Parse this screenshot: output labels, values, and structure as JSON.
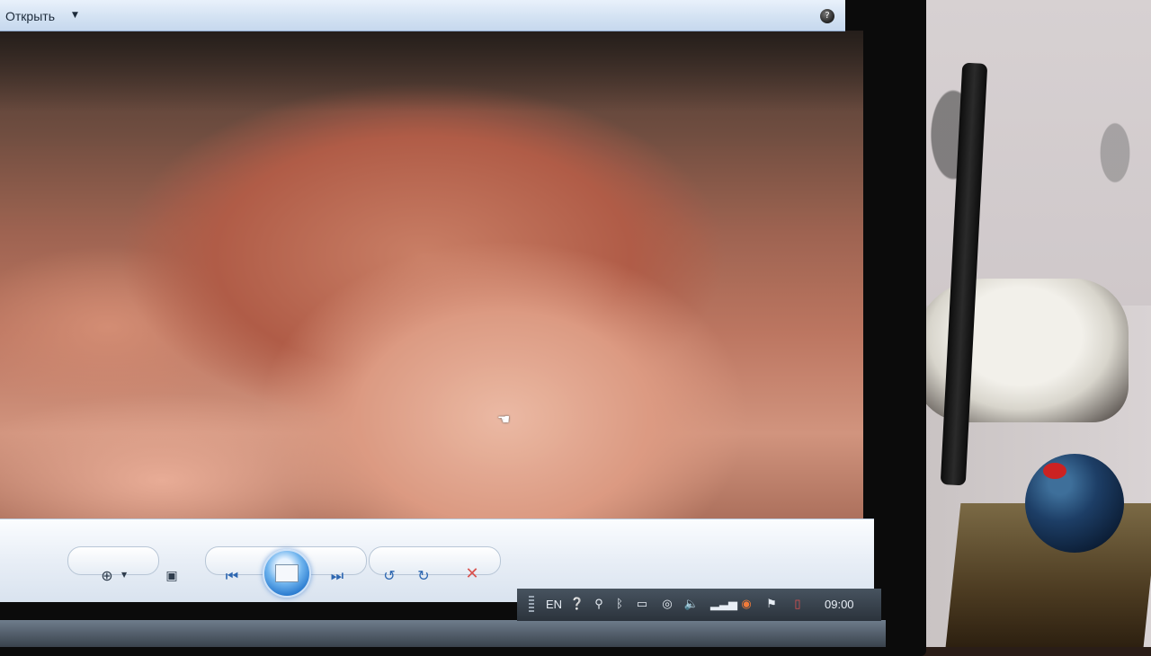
{
  "window": {
    "menu_open_label": "Открыть",
    "help_label": "?"
  },
  "viewer_controls": {
    "zoom_icon": "zoom-icon",
    "fit_icon": "fit-to-window-icon",
    "previous_icon": "previous-icon",
    "slideshow_icon": "slideshow-icon",
    "next_icon": "next-icon",
    "rotate_left_icon": "rotate-counterclockwise-icon",
    "rotate_right_icon": "rotate-clockwise-icon",
    "delete_icon": "delete-icon"
  },
  "taskbar": {
    "language": "EN",
    "clock": "09:00"
  },
  "colors": {
    "accent": "#2e67b1",
    "delete": "#d9534f",
    "taskbar": "#2b333c"
  }
}
